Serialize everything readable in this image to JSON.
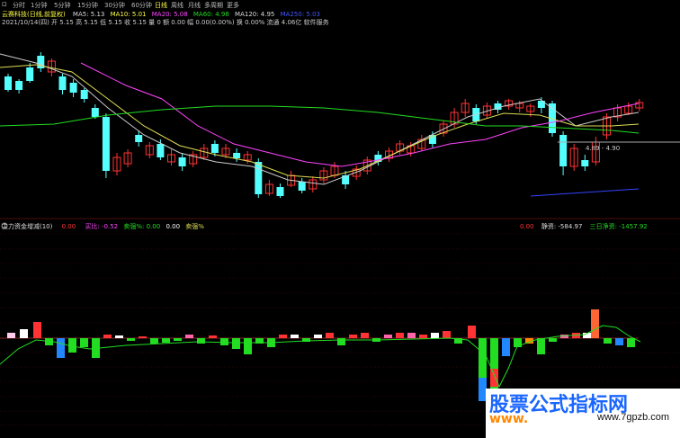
{
  "tabs": [
    {
      "label": "⊡",
      "active": false
    },
    {
      "label": "分时",
      "active": false
    },
    {
      "label": "1分钟",
      "active": false
    },
    {
      "label": "5分钟",
      "active": false
    },
    {
      "label": "15分钟",
      "active": false
    },
    {
      "label": "30分钟",
      "active": false
    },
    {
      "label": "60分钟",
      "active": false
    },
    {
      "label": "日线",
      "active": true
    },
    {
      "label": "周线",
      "active": false
    },
    {
      "label": "月线",
      "active": false
    },
    {
      "label": "多周期",
      "active": false
    },
    {
      "label": "更多",
      "active": false
    }
  ],
  "stock_info": {
    "name": "云赛科技(日线,前复权)",
    "ma5": "MA5: 5.13",
    "ma10": "MA10: 5.01",
    "ma20": "MA20: 5.08",
    "ma60": "MA60: 4.98",
    "ma120": "MA120: 4.95",
    "ma250": "MA250: 5.03"
  },
  "quote_line": "2021/10/14(四) 开 5.15 高 5.15 低 5.15 收 5.15 量 0 额 0.00 幅 0.00(0.00%) 换 0.00% 流通 4.06亿 软件服务",
  "price_labels": {
    "low": "4.89",
    "high": "4.90"
  },
  "indicator": {
    "title": "主力资金增减(10)",
    "v1": "0.00",
    "v2": "买比: -0.52",
    "v3": "卖强%: 0.00",
    "v4": "0.00",
    "v5": "卖强%",
    "right1": "0.00",
    "right2": "静资: -584.97",
    "right3": "三日净资: -1457.92"
  },
  "colors": {
    "up": "#ff3333",
    "down": "#54ffff",
    "ma5": "#cccccc",
    "ma10": "#dddd55",
    "ma20": "#ff44ff",
    "ma60": "#22dd22",
    "ma120": "#3344ff",
    "ma250": "#aaaaaa"
  },
  "watermark": {
    "line1": "股票公式指标网",
    "line2": "www.",
    "line3": "www.7gpzb.com"
  }
}
